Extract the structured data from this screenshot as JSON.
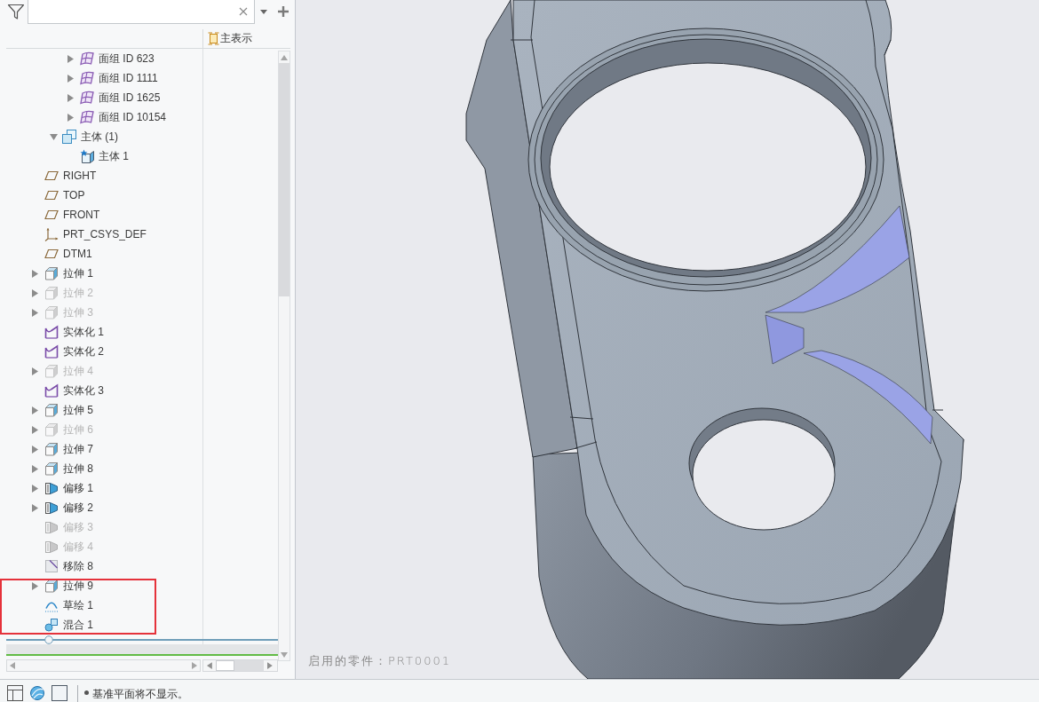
{
  "tree": {
    "column_2_header": "主表示",
    "items": [
      {
        "children": [
          {
            "children": [
              {
                "label": "面组 ID 623",
                "kind": "quilt",
                "expanded": false,
                "disabled": false
              },
              {
                "label": "面组 ID 1111",
                "kind": "quilt",
                "expanded": false,
                "disabled": false
              },
              {
                "label": "面组 ID 1625",
                "kind": "quilt",
                "expanded": false,
                "disabled": false
              },
              {
                "label": "面组 ID 10154",
                "kind": "quilt",
                "expanded": false,
                "disabled": false
              }
            ]
          },
          {
            "label": "主体 (1)",
            "kind": "body-group",
            "expanded": true,
            "disabled": false,
            "children": [
              {
                "label": "主体 1",
                "kind": "body",
                "disabled": false
              }
            ]
          }
        ]
      },
      {
        "label": "RIGHT",
        "kind": "datum-plane",
        "disabled": false
      },
      {
        "label": "TOP",
        "kind": "datum-plane",
        "disabled": false
      },
      {
        "label": "FRONT",
        "kind": "datum-plane",
        "disabled": false
      },
      {
        "label": "PRT_CSYS_DEF",
        "kind": "csys",
        "disabled": false
      },
      {
        "label": "DTM1",
        "kind": "datum-plane",
        "disabled": false
      },
      {
        "label": "拉伸 1",
        "kind": "extrude",
        "expanded": false,
        "disabled": false
      },
      {
        "label": "拉伸 2",
        "kind": "extrude",
        "expanded": false,
        "disabled": true
      },
      {
        "label": "拉伸 3",
        "kind": "extrude",
        "expanded": false,
        "disabled": true
      },
      {
        "label": "实体化 1",
        "kind": "solidify",
        "disabled": false
      },
      {
        "label": "实体化 2",
        "kind": "solidify",
        "disabled": false
      },
      {
        "label": "拉伸 4",
        "kind": "extrude",
        "expanded": false,
        "disabled": true
      },
      {
        "label": "实体化 3",
        "kind": "solidify",
        "disabled": false
      },
      {
        "label": "拉伸 5",
        "kind": "extrude",
        "expanded": false,
        "disabled": false
      },
      {
        "label": "拉伸 6",
        "kind": "extrude",
        "expanded": false,
        "disabled": true
      },
      {
        "label": "拉伸 7",
        "kind": "extrude",
        "expanded": false,
        "disabled": false
      },
      {
        "label": "拉伸 8",
        "kind": "extrude",
        "expanded": false,
        "disabled": false
      },
      {
        "label": "偏移 1",
        "kind": "offset",
        "expanded": false,
        "disabled": false
      },
      {
        "label": "偏移 2",
        "kind": "offset",
        "expanded": false,
        "disabled": false
      },
      {
        "label": "偏移 3",
        "kind": "offset",
        "disabled": true
      },
      {
        "label": "偏移 4",
        "kind": "offset",
        "disabled": true
      },
      {
        "label": "移除 8",
        "kind": "remove",
        "disabled": false
      }
    ],
    "framed_items": [
      {
        "label": "拉伸 9",
        "kind": "extrude",
        "expanded": false,
        "disabled": false
      },
      {
        "label": "草绘 1",
        "kind": "sketch",
        "disabled": false
      },
      {
        "label": "混合 1",
        "kind": "blend",
        "disabled": false
      }
    ]
  },
  "viewport": {
    "caption": "启用的零件：PRT0001"
  },
  "status_bar": {
    "message": "基准平面将不显示。"
  }
}
